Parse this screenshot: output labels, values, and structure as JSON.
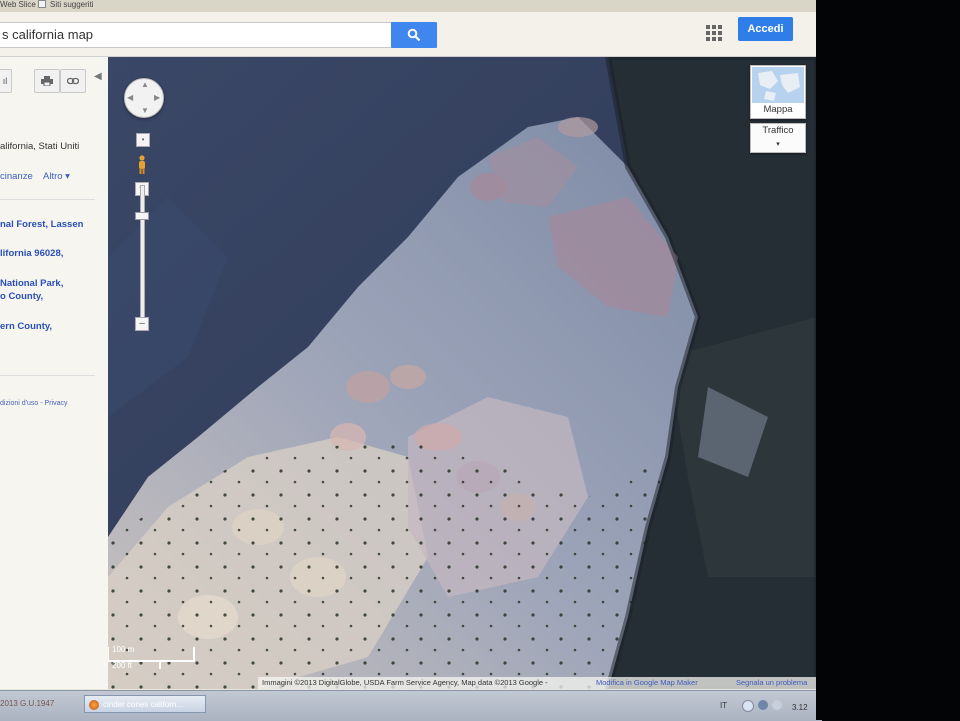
{
  "bookmarks": {
    "item1": "Web Slice",
    "item2": "Siti suggeriti"
  },
  "search": {
    "value": "s california map",
    "button_icon": "search-icon"
  },
  "header": {
    "apps_icon": "apps-grid-icon",
    "signin_label": "Accedi"
  },
  "left_panel": {
    "location": "alifornia, Stati Uniti",
    "nearby": "cinanze",
    "more": "Altro",
    "results": [
      {
        "line1": "nal Forest, Lassen"
      },
      {
        "line1": "lifornia 96028,"
      },
      {
        "line1": "National Park,",
        "line2": "o County,"
      },
      {
        "line1": "ern County,"
      }
    ],
    "footer": "dizioni d'uso - Privacy"
  },
  "map": {
    "map_type_label": "Mappa",
    "traffic_label": "Traffico",
    "scale_m": "100 m",
    "scale_ft": "200 ft",
    "attribution": "Immagini ©2013 DigitalGlobe, USDA Farm Service Agency, Map data ©2013 Google -",
    "edit_link": "Modifica in Google Map Maker",
    "report_link": "Segnala un problema"
  },
  "taskbar": {
    "date_text": "2013 G.U.1947",
    "window_label": "cinder cones californ...",
    "lang": "IT",
    "clock": "3.12"
  },
  "colors": {
    "accent_blue": "#2e7de8",
    "link_blue": "#2a4fb6"
  }
}
